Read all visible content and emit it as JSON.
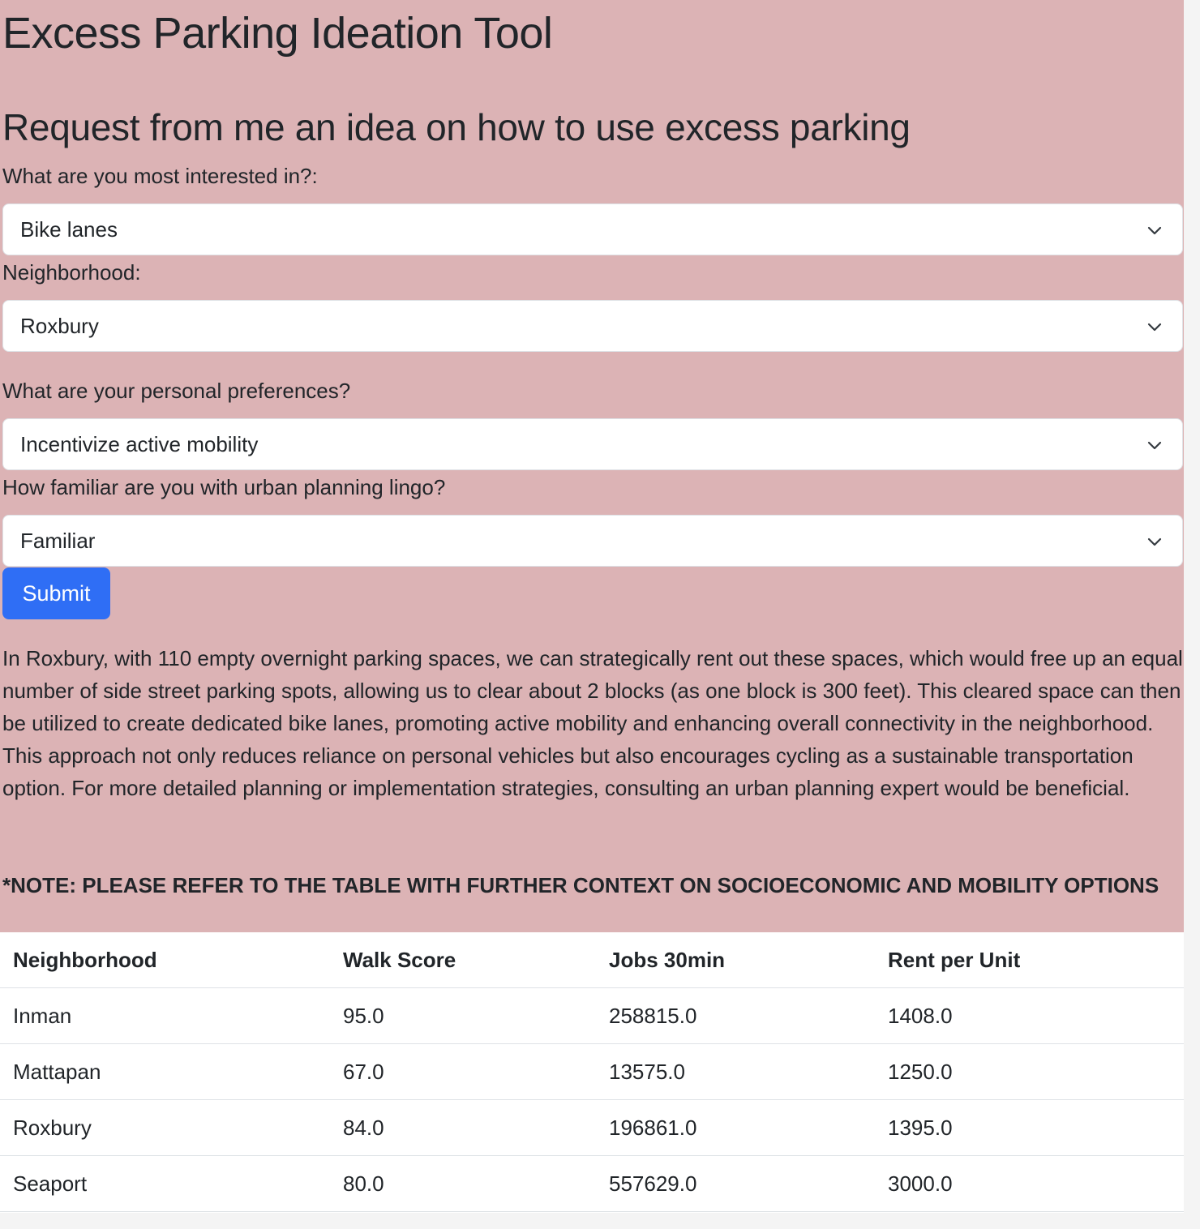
{
  "app": {
    "title": "Excess Parking Ideation Tool",
    "subtitle": "Request from me an idea on how to use excess parking"
  },
  "form": {
    "interest_label": "What are you most interested in?:",
    "interest_value": "Bike lanes",
    "neighborhood_label": "Neighborhood:",
    "neighborhood_value": "Roxbury",
    "preferences_label": "What are your personal preferences?",
    "preferences_value": "Incentivize active mobility",
    "familiarity_label": "How familiar are you with urban planning lingo?",
    "familiarity_value": "Familiar",
    "submit_label": "Submit"
  },
  "result": {
    "text": "In Roxbury, with 110 empty overnight parking spaces, we can strategically rent out these spaces, which would free up an equal number of side street parking spots, allowing us to clear about 2 blocks (as one block is 300 feet). This cleared space can then be utilized to create dedicated bike lanes, promoting active mobility and enhancing overall connectivity in the neighborhood. This approach not only reduces reliance on personal vehicles but also encourages cycling as a sustainable transportation option. For more detailed planning or implementation strategies, consulting an urban planning expert would be beneficial.",
    "note": "*NOTE: PLEASE REFER TO THE TABLE WITH FURTHER CONTEXT ON SOCIOECONOMIC AND MOBILITY OPTIONS"
  },
  "table": {
    "headers": [
      "Neighborhood",
      "Walk Score",
      "Jobs 30min",
      "Rent per Unit"
    ],
    "rows": [
      [
        "Inman",
        "95.0",
        "258815.0",
        "1408.0"
      ],
      [
        "Mattapan",
        "67.0",
        "13575.0",
        "1250.0"
      ],
      [
        "Roxbury",
        "84.0",
        "196861.0",
        "1395.0"
      ],
      [
        "Seaport",
        "80.0",
        "557629.0",
        "3000.0"
      ]
    ]
  },
  "colors": {
    "background": "#dcb3b5",
    "primary_button": "#2f6ef5"
  },
  "icons": {
    "select_arrow": "chevron-down-icon"
  }
}
